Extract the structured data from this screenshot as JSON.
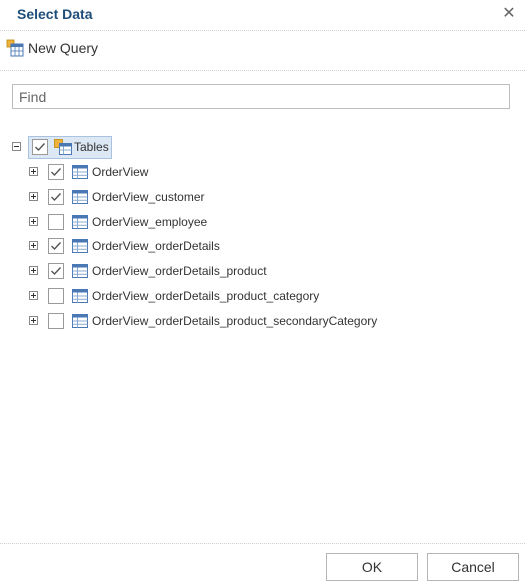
{
  "dialog": {
    "title": "Select Data",
    "close_icon": "close-icon"
  },
  "toolbar": {
    "new_query_label": "New Query",
    "new_query_icon": "new-query-icon"
  },
  "find": {
    "placeholder": "Find",
    "value": ""
  },
  "tree": {
    "root": {
      "label": "Tables",
      "checked": true,
      "expanded": true,
      "icon": "tables-icon"
    },
    "items": [
      {
        "label": "OrderView",
        "checked": true,
        "expanded": false,
        "icon": "table-icon"
      },
      {
        "label": "OrderView_customer",
        "checked": true,
        "expanded": false,
        "icon": "table-icon"
      },
      {
        "label": "OrderView_employee",
        "checked": false,
        "expanded": false,
        "icon": "table-icon"
      },
      {
        "label": "OrderView_orderDetails",
        "checked": true,
        "expanded": false,
        "icon": "table-icon"
      },
      {
        "label": "OrderView_orderDetails_product",
        "checked": true,
        "expanded": false,
        "icon": "table-icon"
      },
      {
        "label": "OrderView_orderDetails_product_category",
        "checked": false,
        "expanded": false,
        "icon": "table-icon"
      },
      {
        "label": "OrderView_orderDetails_product_secondaryCategory",
        "checked": false,
        "expanded": false,
        "icon": "table-icon"
      }
    ]
  },
  "footer": {
    "ok_label": "OK",
    "cancel_label": "Cancel"
  },
  "colors": {
    "title": "#1f4e79",
    "selection_bg": "#dde8f5",
    "selection_border": "#a8c2e0"
  }
}
